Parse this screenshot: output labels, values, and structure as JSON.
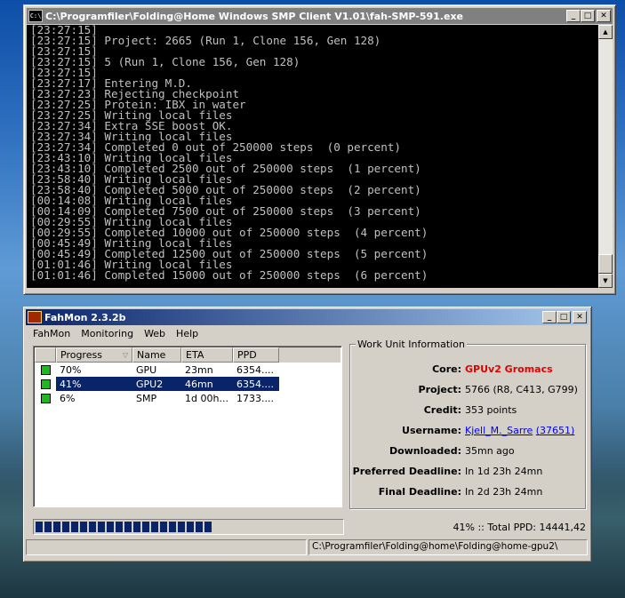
{
  "console": {
    "title": "C:\\Programfiler\\Folding@Home Windows SMP Client V1.01\\fah-SMP-591.exe",
    "icon": "cmd-icon",
    "lines": [
      "[23:27:15]",
      "[23:27:15] Project: 2665 (Run 1, Clone 156, Gen 128)",
      "[23:27:15]",
      "[23:27:15] 5 (Run 1, Clone 156, Gen 128)",
      "[23:27:15]",
      "[23:27:17] Entering M.D.",
      "[23:27:23] Rejecting checkpoint",
      "[23:27:25] Protein: IBX in water",
      "[23:27:25] Writing local files",
      "[23:27:34] Extra SSE boost OK.",
      "[23:27:34] Writing local files",
      "[23:27:34] Completed 0 out of 250000 steps  (0 percent)",
      "[23:43:10] Writing local files",
      "[23:43:10] Completed 2500 out of 250000 steps  (1 percent)",
      "[23:58:40] Writing local files",
      "[23:58:40] Completed 5000 out of 250000 steps  (2 percent)",
      "[00:14:08] Writing local files",
      "[00:14:09] Completed 7500 out of 250000 steps  (3 percent)",
      "[00:29:55] Writing local files",
      "[00:29:55] Completed 10000 out of 250000 steps  (4 percent)",
      "[00:45:49] Writing local files",
      "[00:45:49] Completed 12500 out of 250000 steps  (5 percent)",
      "[01:01:46] Writing local files",
      "[01:01:46] Completed 15000 out of 250000 steps  (6 percent)"
    ]
  },
  "fahmon": {
    "title": "FahMon 2.3.2b",
    "menu": [
      "FahMon",
      "Monitoring",
      "Web",
      "Help"
    ],
    "columns": {
      "progress": "Progress",
      "name": "Name",
      "eta": "ETA",
      "ppd": "PPD"
    },
    "clients": [
      {
        "progress": "70%",
        "name": "GPU",
        "eta": "23mn",
        "ppd": "6354....",
        "status_color": "#1fb81f",
        "selected": false
      },
      {
        "progress": "41%",
        "name": "GPU2",
        "eta": "46mn",
        "ppd": "6354....",
        "status_color": "#1fb81f",
        "selected": true
      },
      {
        "progress": "6%",
        "name": "SMP",
        "eta": "1d 00h...",
        "ppd": "1733....",
        "status_color": "#1fb81f",
        "selected": false
      }
    ],
    "wu": {
      "legend": "Work Unit Information",
      "core_label": "Core:",
      "core_value": "GPUv2 Gromacs",
      "project_label": "Project:",
      "project_value": "5766 (R8, C413, G799)",
      "credit_label": "Credit:",
      "credit_value": "353 points",
      "username_label": "Username:",
      "username_name": "Kjell_M._Sarre",
      "username_team": "(37651)",
      "downloaded_label": "Downloaded:",
      "downloaded_value": "35mn ago",
      "preferred_label": "Preferred Deadline:",
      "preferred_value": "In 1d 23h 24mn",
      "final_label": "Final Deadline:",
      "final_value": "In 2d 23h 24mn"
    },
    "progress_fraction": 0.57,
    "progress_text": "41% :: Total PPD: 14441,42",
    "statusbar": {
      "left": "",
      "path": "C:\\Programfiler\\Folding@home\\Folding@home-gpu2\\"
    }
  },
  "colors": {
    "selection": "#0a246a",
    "core_red": "#e00000",
    "link": "#0000ee"
  }
}
